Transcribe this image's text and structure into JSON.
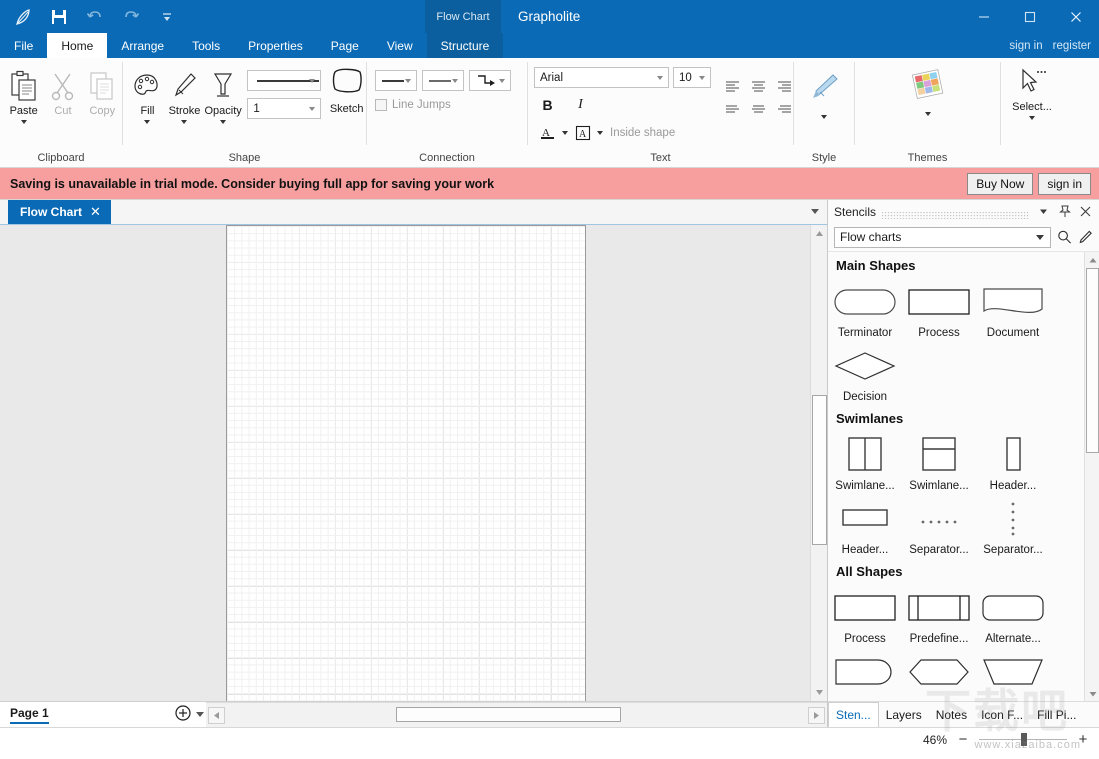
{
  "titlebar": {
    "quick_access": [
      {
        "name": "feather-icon",
        "label": "Feather"
      },
      {
        "name": "save-icon",
        "label": "Save"
      },
      {
        "name": "undo-icon",
        "label": "Undo"
      },
      {
        "name": "redo-icon",
        "label": "Redo"
      },
      {
        "name": "customize-qat-icon",
        "label": "Customize Quick Access Toolbar"
      }
    ],
    "context_tab": "Flow Chart",
    "app_title": "Grapholite",
    "window_controls": {
      "minimize": "─",
      "maximize": "□",
      "close": "✕"
    }
  },
  "ribbon_tabs": [
    {
      "label": "File",
      "active": false,
      "context": false
    },
    {
      "label": "Home",
      "active": true,
      "context": false
    },
    {
      "label": "Arrange",
      "active": false,
      "context": false
    },
    {
      "label": "Tools",
      "active": false,
      "context": false
    },
    {
      "label": "Properties",
      "active": false,
      "context": false
    },
    {
      "label": "Page",
      "active": false,
      "context": false
    },
    {
      "label": "View",
      "active": false,
      "context": false
    },
    {
      "label": "Structure",
      "active": false,
      "context": true
    }
  ],
  "account_links": {
    "sign_in": "sign in",
    "register": "register"
  },
  "ribbon": {
    "clipboard": {
      "label": "Clipboard",
      "paste": "Paste",
      "cut": "Cut",
      "copy": "Copy"
    },
    "shape": {
      "label": "Shape",
      "fill": "Fill",
      "stroke": "Stroke",
      "opacity": "Opacity",
      "opacity_value": "1",
      "sketch": "Sketch"
    },
    "connection": {
      "label": "Connection",
      "line_jumps": "Line Jumps",
      "line_jumps_checked": false
    },
    "text": {
      "label": "Text",
      "font_family": "Arial",
      "font_size": "10",
      "bold": "B",
      "italic": "I",
      "text_position": "Inside shape"
    },
    "style": {
      "label": "Style"
    },
    "themes": {
      "label": "Themes"
    },
    "select": {
      "label": "Select..."
    }
  },
  "banner": {
    "message": "Saving is unavailable in trial mode. Consider buying full app for saving your work",
    "buy_now": "Buy Now",
    "sign_in": "sign in",
    "background": "#f79e9e"
  },
  "document_tabs": [
    {
      "label": "Flow Chart",
      "close": "✕",
      "active": true
    }
  ],
  "stencils": {
    "panel_title": "Stencils",
    "selected_library": "Flow charts",
    "sections": [
      {
        "title": "Main Shapes",
        "shapes": [
          {
            "caption": "Terminator",
            "icon": "terminator-shape"
          },
          {
            "caption": "Process",
            "icon": "process-shape"
          },
          {
            "caption": "Document",
            "icon": "document-shape"
          },
          {
            "caption": "Decision",
            "icon": "decision-shape"
          }
        ]
      },
      {
        "title": "Swimlanes",
        "shapes": [
          {
            "caption": "Swimlane...",
            "icon": "swimlane-vertical-shape"
          },
          {
            "caption": "Swimlane...",
            "icon": "swimlane-horizontal-shape"
          },
          {
            "caption": "Header...",
            "icon": "header-vertical-shape"
          },
          {
            "caption": "Header...",
            "icon": "header-horizontal-shape"
          },
          {
            "caption": "Separator...",
            "icon": "separator-horizontal-shape"
          },
          {
            "caption": "Separator...",
            "icon": "separator-vertical-shape"
          }
        ]
      },
      {
        "title": "All Shapes",
        "shapes": [
          {
            "caption": "Process",
            "icon": "process-shape"
          },
          {
            "caption": "Predefine...",
            "icon": "predefined-process-shape"
          },
          {
            "caption": "Alternate...",
            "icon": "alternate-process-shape"
          },
          {
            "caption": "",
            "icon": "delay-shape"
          },
          {
            "caption": "",
            "icon": "preparation-shape"
          },
          {
            "caption": "",
            "icon": "manual-operation-shape"
          }
        ]
      }
    ],
    "bottom_tabs": [
      {
        "label": "Sten...",
        "active": true
      },
      {
        "label": "Layers",
        "active": false
      },
      {
        "label": "Notes",
        "active": false
      },
      {
        "label": "Icon F...",
        "active": false
      },
      {
        "label": "Fill Pi...",
        "active": false
      }
    ]
  },
  "pagebar": {
    "page_label": "Page 1"
  },
  "statusbar": {
    "zoom": "46%",
    "zoom_out": "−",
    "zoom_in": "+",
    "watermark": "www.xiazaiba.com"
  }
}
